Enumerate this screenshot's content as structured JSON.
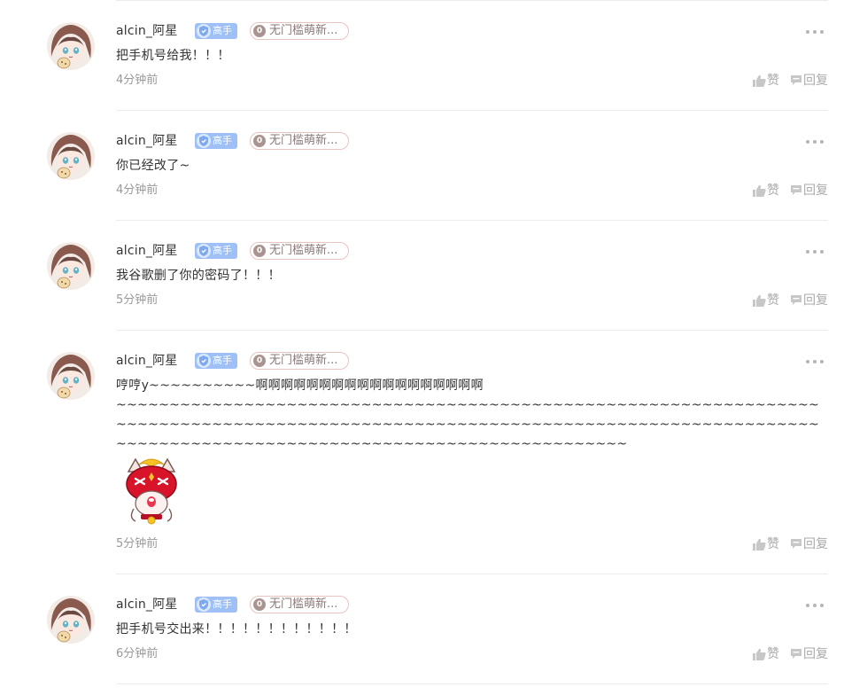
{
  "comments": [
    {
      "username": "alcin_阿星",
      "level_label": "高手",
      "badge_count": "0",
      "badge_text": "无门槛萌新...",
      "content": "把手机号给我！！！",
      "time": "4分钟前",
      "like_label": "赞",
      "reply_label": "回复"
    },
    {
      "username": "alcin_阿星",
      "level_label": "高手",
      "badge_count": "0",
      "badge_text": "无门槛萌新...",
      "content": "你已经改了~",
      "time": "4分钟前",
      "like_label": "赞",
      "reply_label": "回复"
    },
    {
      "username": "alcin_阿星",
      "level_label": "高手",
      "badge_count": "0",
      "badge_text": "无门槛萌新...",
      "content": "我谷歌删了你的密码了！！！",
      "time": "5分钟前",
      "like_label": "赞",
      "reply_label": "回复"
    },
    {
      "username": "alcin_阿星",
      "level_label": "高手",
      "badge_count": "0",
      "badge_text": "无门槛萌新...",
      "content": "哼哼y~~~~~~~~~~啊啊啊啊啊啊啊啊啊啊啊啊啊啊啊啊啊啊\n~~~~~~~~~~~~~~~~~~~~~~~~~~~~~~~~~~~~~~~~~~~~~~~~~~~~~~~~~~~~~~~~~~~~~~~~~~~~~~~~~~~~~~~~~~~~~~~~~~~~~~~~~~~~~~~~~~~~~~~~~~~~~~~~~~~~~~~~~~~~~~~~~~~~~~~~~~~~~~~~~~~~~~~~~~~~~~~~~~~~",
      "time": "5分钟前",
      "like_label": "赞",
      "reply_label": "回复"
    },
    {
      "username": "alcin_阿星",
      "level_label": "高手",
      "badge_count": "0",
      "badge_text": "无门槛萌新...",
      "content": "把手机号交出来！！！！！！！！！！！！",
      "time": "6分钟前",
      "like_label": "赞",
      "reply_label": "回复"
    }
  ],
  "colors": {
    "level_badge": "#9ec0f7",
    "fan_badge_border": "#e8c4bf",
    "meta_text": "#999999",
    "action_text": "#aaaaaa"
  },
  "icons": {
    "level": "shield-icon",
    "like": "thumbs-up-icon",
    "reply": "comment-icon",
    "more": "more-dots-icon",
    "sticker": "red-masked-fox-sticker"
  }
}
